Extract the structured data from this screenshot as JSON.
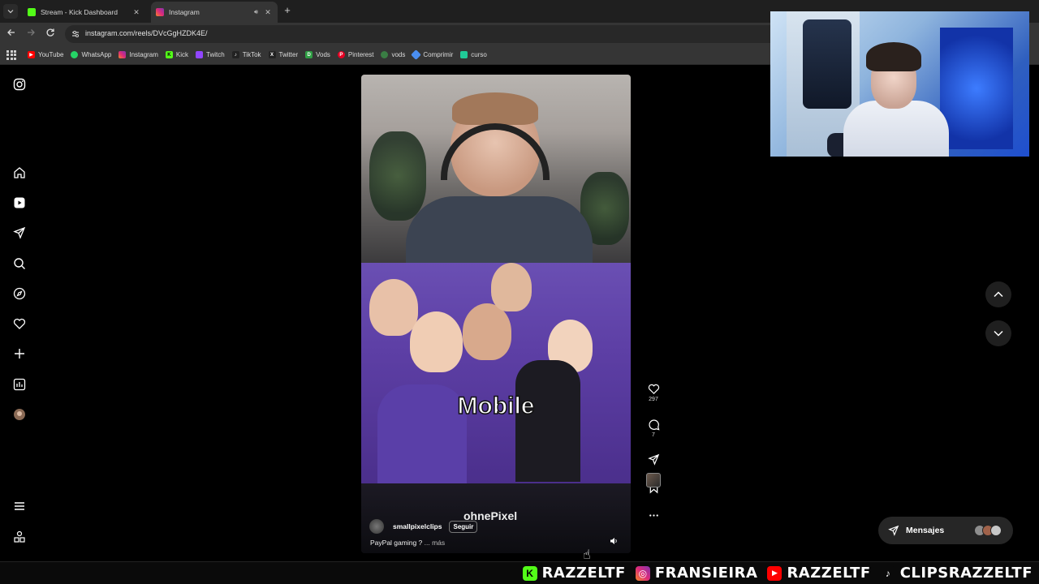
{
  "browser": {
    "tabs": [
      {
        "title": "Stream - Kick Dashboard",
        "favicon_color": "#53fc18",
        "active": false
      },
      {
        "title": "Instagram",
        "favicon_color": "#d6249f",
        "active": true
      }
    ],
    "url": "instagram.com/reels/DVcGgHZDK4E/",
    "bookmarks": [
      {
        "label": "YouTube",
        "color": "#ff0000",
        "icon": "youtube-icon"
      },
      {
        "label": "WhatsApp",
        "color": "#25d366",
        "icon": "whatsapp-icon"
      },
      {
        "label": "Instagram",
        "color": "#d6249f",
        "icon": "instagram-icon"
      },
      {
        "label": "Kick",
        "color": "#53fc18",
        "icon": "kick-icon"
      },
      {
        "label": "Twitch",
        "color": "#9146ff",
        "icon": "twitch-icon"
      },
      {
        "label": "TikTok",
        "color": "#222222",
        "icon": "tiktok-icon"
      },
      {
        "label": "Twitter",
        "color": "#222222",
        "icon": "twitter-icon"
      },
      {
        "label": "Vods",
        "color": "#2f9e44",
        "icon": "vods-icon"
      },
      {
        "label": "Pinterest",
        "color": "#e60023",
        "icon": "pinterest-icon"
      },
      {
        "label": "vods",
        "color": "#3a7d44",
        "icon": "vods-icon"
      },
      {
        "label": "Comprimir",
        "color": "#4a8ef0",
        "icon": "comprimir-icon"
      },
      {
        "label": "curso",
        "color": "#20c997",
        "icon": "curso-icon"
      }
    ]
  },
  "reel": {
    "overlay_text": "Mobile",
    "watermark": "ohnePixel",
    "username": "smallpixelclips",
    "follow_label": "Seguir",
    "caption": "PayPal gaming ?",
    "caption_more": "... más",
    "likes": "297",
    "comments": "7"
  },
  "messages": {
    "label": "Mensajes"
  },
  "banner": [
    {
      "text": "RAZZELTF",
      "icon": "kick-icon",
      "color": "#53fc18",
      "glyph": "K"
    },
    {
      "text": "FRANSIEIRA",
      "icon": "instagram-icon",
      "color": "#d6249f",
      "glyph": "◎"
    },
    {
      "text": "RAZZELTF",
      "icon": "youtube-icon",
      "color": "#ff0000",
      "glyph": "▶"
    },
    {
      "text": "CLIPSRAZZELTF",
      "icon": "tiktok-icon",
      "color": "#0a0a0a",
      "glyph": "♪"
    }
  ],
  "colors": {
    "accent": "#0095f6",
    "background": "#000000"
  }
}
